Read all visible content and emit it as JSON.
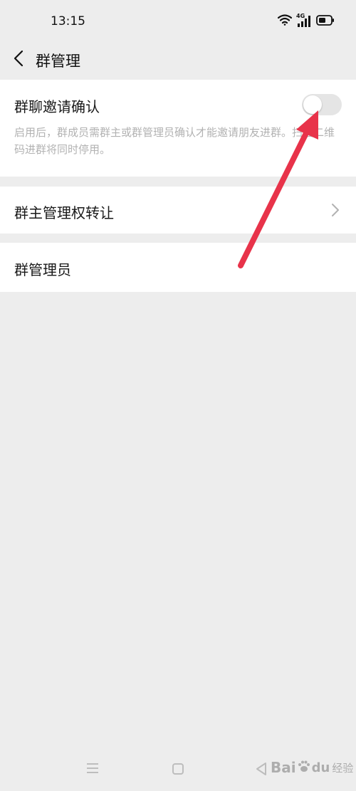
{
  "status_bar": {
    "time": "13:15",
    "network_label": "4G",
    "icons": [
      "wifi-icon",
      "signal-icon",
      "battery-icon"
    ]
  },
  "header": {
    "title": "群管理",
    "back_icon": "chevron-left-icon"
  },
  "settings": {
    "invite_confirm": {
      "label": "群聊邀请确认",
      "enabled": false,
      "description": "启用后，群成员需群主或群管理员确认才能邀请朋友进群。扫描二维码进群将同时停用。"
    },
    "transfer_owner": {
      "label": "群主管理权转让",
      "icon": "chevron-right-icon"
    },
    "admins": {
      "label": "群管理员"
    }
  },
  "annotation": {
    "type": "arrow",
    "color": "#e8334a"
  },
  "bottom_nav": {
    "icons": [
      "menu-icon",
      "home-icon",
      "back-triangle-icon"
    ]
  },
  "watermark": {
    "brand_latin_1": "Bai",
    "brand_latin_2": "du",
    "brand_cn": "经验"
  },
  "colors": {
    "background": "#ededed",
    "card": "#ffffff",
    "text_primary": "#191919",
    "text_secondary": "#b2b2b2",
    "toggle_off": "#e5e5e5"
  }
}
